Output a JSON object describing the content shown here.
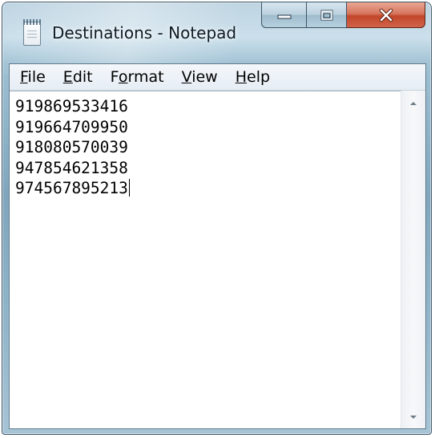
{
  "window": {
    "title": "Destinations - Notepad",
    "app": "Notepad"
  },
  "caption_buttons": {
    "minimize_icon": "minimize-icon",
    "maximize_icon": "maximize-icon",
    "close_icon": "close-icon"
  },
  "menu": {
    "items": [
      {
        "label": "File",
        "accel": "F",
        "rest": "ile",
        "prefix": ""
      },
      {
        "label": "Edit",
        "accel": "E",
        "rest": "dit",
        "prefix": ""
      },
      {
        "label": "Format",
        "accel": "o",
        "rest": "rmat",
        "prefix": "F"
      },
      {
        "label": "View",
        "accel": "V",
        "rest": "iew",
        "prefix": ""
      },
      {
        "label": "Help",
        "accel": "H",
        "rest": "elp",
        "prefix": ""
      }
    ]
  },
  "editor": {
    "lines": [
      "919869533416",
      "919664709950",
      "918080570039",
      "947854621358",
      "974567895213"
    ]
  },
  "scrollbar": {
    "up_icon": "scroll-up-arrow-icon",
    "down_icon": "scroll-down-arrow-icon"
  },
  "colors": {
    "frame": "#8fb3c8",
    "close_button": "#c2462a",
    "editor_background": "#ffffff"
  }
}
